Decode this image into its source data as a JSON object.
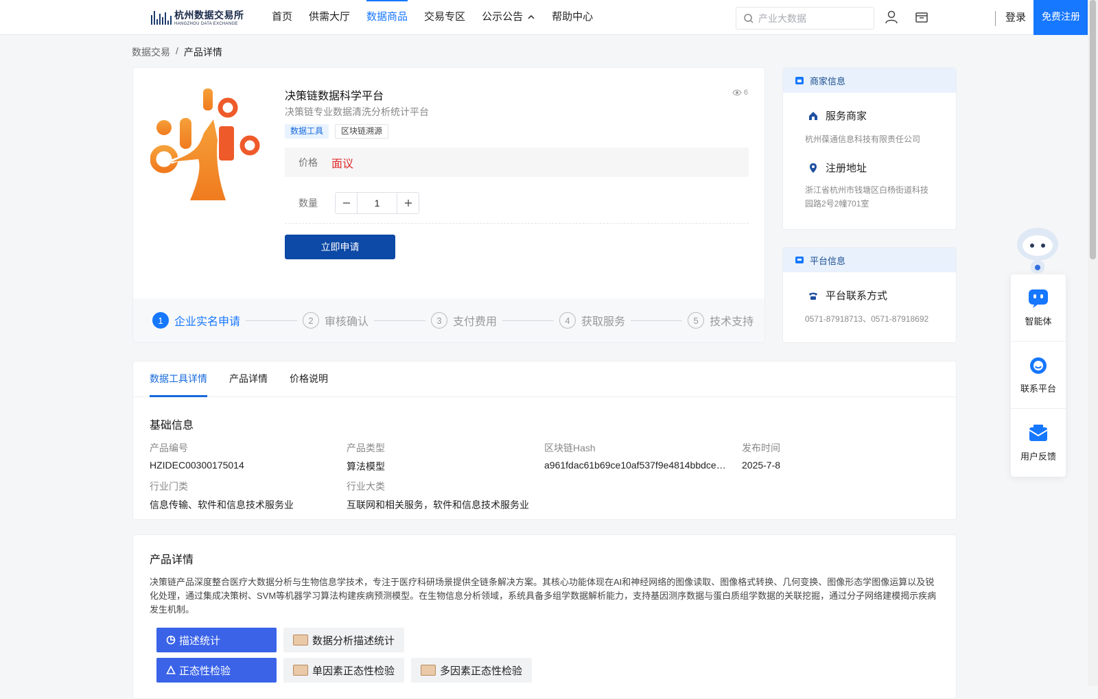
{
  "header": {
    "logo_cn": "杭州数据交易所",
    "logo_en": "HANGZHOU DATA EXCHANGE",
    "nav": [
      "首页",
      "供需大厅",
      "数据商品",
      "交易专区",
      "公示公告",
      "帮助中心"
    ],
    "active_nav": "数据商品",
    "search_placeholder": "产业大数据",
    "login": "登录",
    "register": "免费注册",
    "accent_color": "#1677ff"
  },
  "breadcrumb": {
    "parent": "数据交易",
    "separator": "/",
    "current": "产品详情"
  },
  "product": {
    "title": "决策链数据科学平台",
    "subtitle": "决策链专业数据清洗分析统计平台",
    "views": "6",
    "tags": [
      "数据工具",
      "区块链溯源"
    ],
    "price_label": "价格",
    "price_value": "面议",
    "qty_label": "数量",
    "qty_value": "1",
    "apply_label": "立即申请",
    "steps": [
      {
        "num": "1",
        "label": "企业实名申请"
      },
      {
        "num": "2",
        "label": "审核确认"
      },
      {
        "num": "3",
        "label": "支付费用"
      },
      {
        "num": "4",
        "label": "获取服务"
      },
      {
        "num": "5",
        "label": "技术支持"
      }
    ]
  },
  "merchant": {
    "head": "商家信息",
    "service_title": "服务商家",
    "service_name": "杭州葆通信息科技有限责任公司",
    "address_title": "注册地址",
    "address": "浙江省杭州市钱塘区白杨街道科技园路2号2幢701室"
  },
  "platform": {
    "head": "平台信息",
    "contact_title": "平台联系方式",
    "contact": "0571-87918713、0571-87918692"
  },
  "tabs": [
    "数据工具详情",
    "产品详情",
    "价格说明"
  ],
  "basic": {
    "title": "基础信息",
    "items": [
      {
        "label": "产品编号",
        "value": "HZIDEC00300175014"
      },
      {
        "label": "产品类型",
        "value": "算法模型"
      },
      {
        "label": "区块链Hash",
        "value": "a961fdac61b69ce10af537f9e4814bbdce0..."
      },
      {
        "label": "发布时间",
        "value": "2025-7-8"
      },
      {
        "label": "行业门类",
        "value": "信息传输、软件和信息技术服务业"
      },
      {
        "label": "行业大类",
        "value": "互联网和相关服务，软件和信息技术服务业"
      }
    ]
  },
  "detail": {
    "title": "产品详情",
    "text": "决策链产品深度整合医疗大数据分析与生物信息学技术，专注于医疗科研场景提供全链条解决方案。其核心功能体现在AI和神经网络的图像读取、图像格式转换、几何变换、图像形态学图像运算以及锐化处理，通过集成决策树、SVM等机器学习算法构建疾病预测模型。在生物信息分析领域，系统具备多组学数据解析能力，支持基因测序数据与蛋白质组学数据的关联挖掘，通过分子网络建模揭示疾病发生机制。",
    "features": [
      {
        "main": "描述统计",
        "subs": [
          "数据分析描述统计"
        ]
      },
      {
        "main": "正态性检验",
        "subs": [
          "单因素正态性检验",
          "多因素正态性检验"
        ]
      }
    ]
  },
  "float_tools": [
    "智能体",
    "联系平台",
    "用户反馈"
  ]
}
